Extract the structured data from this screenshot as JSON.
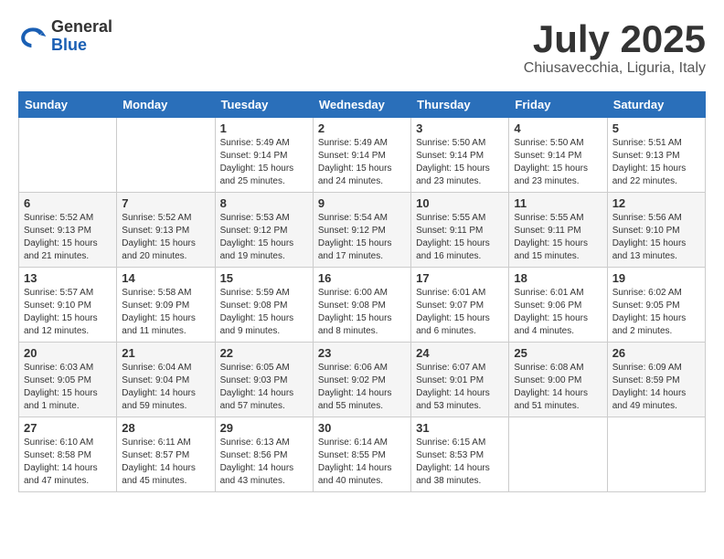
{
  "header": {
    "logo_general": "General",
    "logo_blue": "Blue",
    "month_title": "July 2025",
    "location": "Chiusavecchia, Liguria, Italy"
  },
  "calendar": {
    "days_of_week": [
      "Sunday",
      "Monday",
      "Tuesday",
      "Wednesday",
      "Thursday",
      "Friday",
      "Saturday"
    ],
    "weeks": [
      [
        {
          "day": "",
          "info": ""
        },
        {
          "day": "",
          "info": ""
        },
        {
          "day": "1",
          "info": "Sunrise: 5:49 AM\nSunset: 9:14 PM\nDaylight: 15 hours\nand 25 minutes."
        },
        {
          "day": "2",
          "info": "Sunrise: 5:49 AM\nSunset: 9:14 PM\nDaylight: 15 hours\nand 24 minutes."
        },
        {
          "day": "3",
          "info": "Sunrise: 5:50 AM\nSunset: 9:14 PM\nDaylight: 15 hours\nand 23 minutes."
        },
        {
          "day": "4",
          "info": "Sunrise: 5:50 AM\nSunset: 9:14 PM\nDaylight: 15 hours\nand 23 minutes."
        },
        {
          "day": "5",
          "info": "Sunrise: 5:51 AM\nSunset: 9:13 PM\nDaylight: 15 hours\nand 22 minutes."
        }
      ],
      [
        {
          "day": "6",
          "info": "Sunrise: 5:52 AM\nSunset: 9:13 PM\nDaylight: 15 hours\nand 21 minutes."
        },
        {
          "day": "7",
          "info": "Sunrise: 5:52 AM\nSunset: 9:13 PM\nDaylight: 15 hours\nand 20 minutes."
        },
        {
          "day": "8",
          "info": "Sunrise: 5:53 AM\nSunset: 9:12 PM\nDaylight: 15 hours\nand 19 minutes."
        },
        {
          "day": "9",
          "info": "Sunrise: 5:54 AM\nSunset: 9:12 PM\nDaylight: 15 hours\nand 17 minutes."
        },
        {
          "day": "10",
          "info": "Sunrise: 5:55 AM\nSunset: 9:11 PM\nDaylight: 15 hours\nand 16 minutes."
        },
        {
          "day": "11",
          "info": "Sunrise: 5:55 AM\nSunset: 9:11 PM\nDaylight: 15 hours\nand 15 minutes."
        },
        {
          "day": "12",
          "info": "Sunrise: 5:56 AM\nSunset: 9:10 PM\nDaylight: 15 hours\nand 13 minutes."
        }
      ],
      [
        {
          "day": "13",
          "info": "Sunrise: 5:57 AM\nSunset: 9:10 PM\nDaylight: 15 hours\nand 12 minutes."
        },
        {
          "day": "14",
          "info": "Sunrise: 5:58 AM\nSunset: 9:09 PM\nDaylight: 15 hours\nand 11 minutes."
        },
        {
          "day": "15",
          "info": "Sunrise: 5:59 AM\nSunset: 9:08 PM\nDaylight: 15 hours\nand 9 minutes."
        },
        {
          "day": "16",
          "info": "Sunrise: 6:00 AM\nSunset: 9:08 PM\nDaylight: 15 hours\nand 8 minutes."
        },
        {
          "day": "17",
          "info": "Sunrise: 6:01 AM\nSunset: 9:07 PM\nDaylight: 15 hours\nand 6 minutes."
        },
        {
          "day": "18",
          "info": "Sunrise: 6:01 AM\nSunset: 9:06 PM\nDaylight: 15 hours\nand 4 minutes."
        },
        {
          "day": "19",
          "info": "Sunrise: 6:02 AM\nSunset: 9:05 PM\nDaylight: 15 hours\nand 2 minutes."
        }
      ],
      [
        {
          "day": "20",
          "info": "Sunrise: 6:03 AM\nSunset: 9:05 PM\nDaylight: 15 hours\nand 1 minute."
        },
        {
          "day": "21",
          "info": "Sunrise: 6:04 AM\nSunset: 9:04 PM\nDaylight: 14 hours\nand 59 minutes."
        },
        {
          "day": "22",
          "info": "Sunrise: 6:05 AM\nSunset: 9:03 PM\nDaylight: 14 hours\nand 57 minutes."
        },
        {
          "day": "23",
          "info": "Sunrise: 6:06 AM\nSunset: 9:02 PM\nDaylight: 14 hours\nand 55 minutes."
        },
        {
          "day": "24",
          "info": "Sunrise: 6:07 AM\nSunset: 9:01 PM\nDaylight: 14 hours\nand 53 minutes."
        },
        {
          "day": "25",
          "info": "Sunrise: 6:08 AM\nSunset: 9:00 PM\nDaylight: 14 hours\nand 51 minutes."
        },
        {
          "day": "26",
          "info": "Sunrise: 6:09 AM\nSunset: 8:59 PM\nDaylight: 14 hours\nand 49 minutes."
        }
      ],
      [
        {
          "day": "27",
          "info": "Sunrise: 6:10 AM\nSunset: 8:58 PM\nDaylight: 14 hours\nand 47 minutes."
        },
        {
          "day": "28",
          "info": "Sunrise: 6:11 AM\nSunset: 8:57 PM\nDaylight: 14 hours\nand 45 minutes."
        },
        {
          "day": "29",
          "info": "Sunrise: 6:13 AM\nSunset: 8:56 PM\nDaylight: 14 hours\nand 43 minutes."
        },
        {
          "day": "30",
          "info": "Sunrise: 6:14 AM\nSunset: 8:55 PM\nDaylight: 14 hours\nand 40 minutes."
        },
        {
          "day": "31",
          "info": "Sunrise: 6:15 AM\nSunset: 8:53 PM\nDaylight: 14 hours\nand 38 minutes."
        },
        {
          "day": "",
          "info": ""
        },
        {
          "day": "",
          "info": ""
        }
      ]
    ]
  }
}
